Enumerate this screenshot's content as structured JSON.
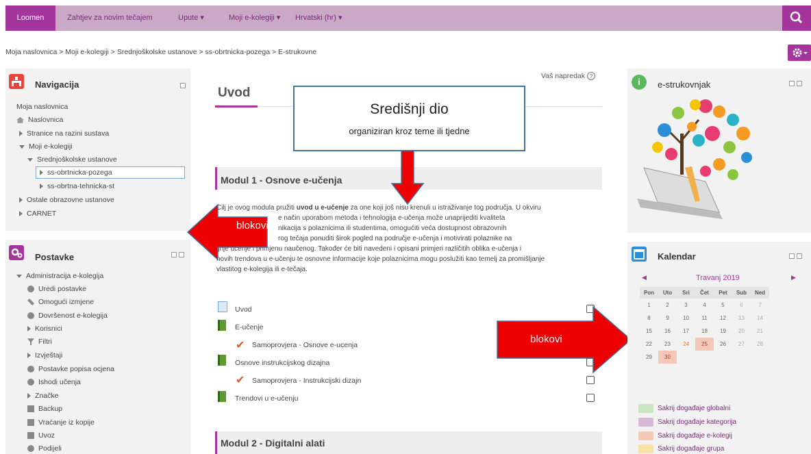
{
  "topnav": {
    "brand": "Loomen",
    "items": [
      "Zahtjev za novim tečajem",
      "Upute ▾",
      "Moji e-kolegiji ▾",
      "Hrvatski (hr) ▾"
    ]
  },
  "breadcrumb": "Moja naslovnica > Moji e-kolegiji > Srednjoškolske ustanove > ss-obrtnicka-pozega > E-strukovne",
  "navigation": {
    "title": "Navigacija",
    "items": [
      "Moja naslovnica",
      "Naslovnica",
      "Stranice na razini sustava",
      "Moji e-kolegiji",
      "Srednjoškolske ustanove",
      "ss-obrtnicka-pozega",
      "ss-obrtna-tehnicka-st",
      "Ostale obrazovne ustanove",
      "CARNET"
    ]
  },
  "settings": {
    "title": "Postavke",
    "items": [
      "Administracija e-kolegija",
      "Uredi postavke",
      "Omogući izmjene",
      "Dovršenost e-kolegija",
      "Korisnici",
      "Filtri",
      "Izvještaji",
      "Postavke popisa ocjena",
      "Ishodi učenja",
      "Značke",
      "Backup",
      "Vraćanje iz kopije",
      "Uvoz",
      "Podijeli"
    ]
  },
  "main": {
    "progress": "Vaš napredak",
    "section_title": "Uvod",
    "module1": "Modul 1 - Osnove e-učenja",
    "description_lines": [
      "Cilj je ovog modula pružiti",
      "uvod u e-učenje",
      "za one koji još nisu krenuli u istraživanje tog područja. U okviru",
      "e način uporabom metoda i tehnologija e-učenja može unaprijediti kvaliteta",
      "nikacija s polaznicima ili studentima, omogućiti veća dostupnost obrazovnih",
      "rog tečaja ponuditi širok pogled na područje e-učenja i motivirati polaznike na",
      "ljnje učenje i primjenu naučenog. Također će biti navedeni i opisani primjeri različitih oblika e-učenja i",
      "novih trendova u e-učenju te osnovne informacije koje polaznicima mogu poslužiti kao temelj za promišljanje",
      "vlastitog e-kolegija ili e-tečaja."
    ],
    "activities": [
      "Uvod",
      "E-učenje",
      "Samoprovjera - Osnove e-ucenja",
      "Osnove instrukcijskog dizajna",
      "Samoprovjera - Instrukcijski dizajn",
      "Trendovi u e-učenju"
    ],
    "module2": "Modul 2 - Digitalni alati"
  },
  "callout": {
    "title": "Središnji dio",
    "subtitle": "organiziran kroz teme ili tjedne"
  },
  "arrows": {
    "left_label": "blokovi",
    "right_label": "blokovi"
  },
  "estrukovnjak": {
    "title": "e-strukovnjak"
  },
  "calendar": {
    "title": "Kalendar",
    "month": "Travanj 2019",
    "days": [
      "Pon",
      "Uto",
      "Sri",
      "Čet",
      "Pet",
      "Sub",
      "Ned"
    ],
    "weeks": [
      [
        "1",
        "2",
        "3",
        "4",
        "5",
        "6",
        "7"
      ],
      [
        "8",
        "9",
        "10",
        "11",
        "12",
        "13",
        "14"
      ],
      [
        "15",
        "16",
        "17",
        "18",
        "19",
        "20",
        "21"
      ],
      [
        "22",
        "23",
        "24",
        "25",
        "26",
        "27",
        "28"
      ],
      [
        "29",
        "30",
        "",
        "",
        "",
        "",
        ""
      ]
    ]
  },
  "events": [
    "Sakrij događaje globalni",
    "Sakrij događaje kategorija",
    "Sakrij događaje e-kolegij",
    "Sakrij događaje grupa"
  ]
}
